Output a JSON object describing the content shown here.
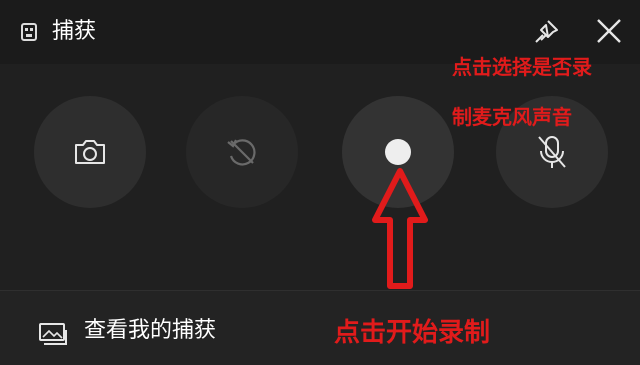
{
  "window": {
    "title": "捕获",
    "app_icon": "game-bar-icon",
    "pin_icon": "pin-icon",
    "close_icon": "close-icon"
  },
  "capture_buttons": [
    {
      "name": "screenshot",
      "icon": "camera-icon",
      "enabled": true
    },
    {
      "name": "record-last-30s",
      "icon": "history-record-icon",
      "enabled": false
    },
    {
      "name": "start-recording",
      "icon": "record-dot-icon",
      "enabled": true
    },
    {
      "name": "mic-toggle",
      "icon": "mic-off-icon",
      "enabled": true
    }
  ],
  "footer": {
    "gallery_label": "查看我的捕获",
    "gallery_icon": "gallery-icon"
  },
  "annotations": {
    "mic_note_line1": "点击选择是否录",
    "mic_note_line2": "制麦克风声音",
    "record_note": "点击开始录制",
    "color": "#e11b1b"
  },
  "colors": {
    "background": "#1f1f1f",
    "titlebar": "#1b1b1b",
    "button": "#2e2e2e",
    "text": "#ffffff"
  }
}
